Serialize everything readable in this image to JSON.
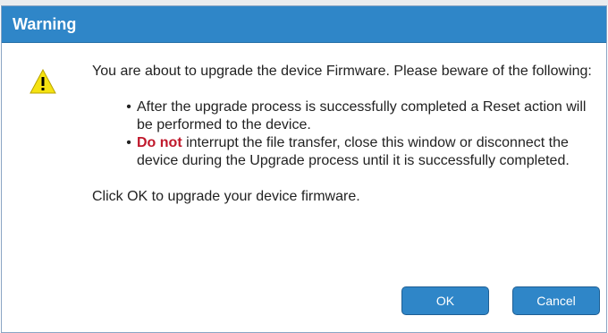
{
  "dialog": {
    "title": "Warning",
    "icon": "warning-icon",
    "intro": "You are about to upgrade the device Firmware. Please beware of the following:",
    "bullets": [
      {
        "prefix": "",
        "text": "After the upgrade process is successfully completed a Reset action will be performed to the device."
      },
      {
        "prefix": "Do not",
        "text": " interrupt the file transfer, close this window or disconnect the device during the Upgrade process until it is successfully completed."
      }
    ],
    "outro": "Click OK to upgrade your device firmware.",
    "buttons": {
      "ok": "OK",
      "cancel": "Cancel"
    }
  },
  "colors": {
    "titlebar": "#2f86c8",
    "button": "#2f86c8",
    "danger": "#c0192c",
    "warning_fill": "#f5e211"
  }
}
